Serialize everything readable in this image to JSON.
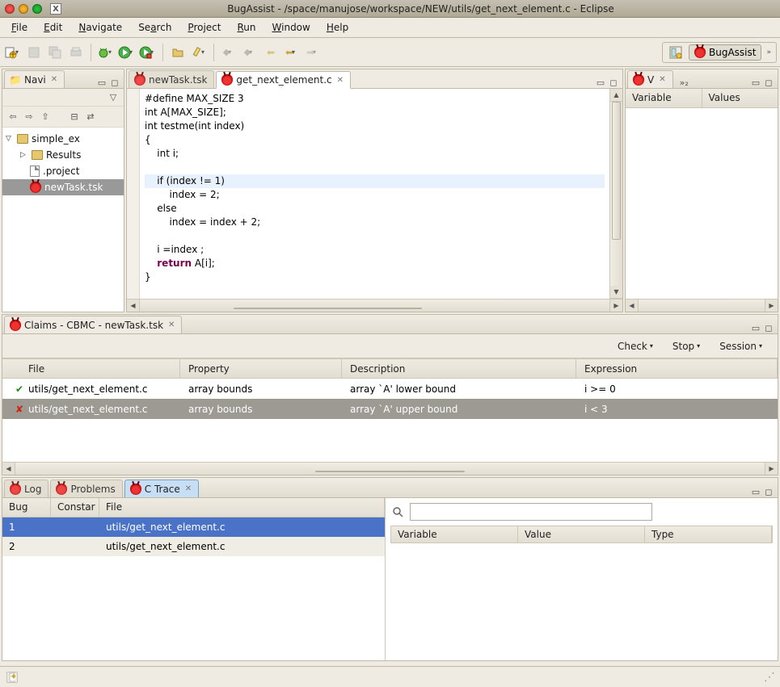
{
  "window": {
    "title": "BugAssist - /space/manujose/workspace/NEW/utils/get_next_element.c - Eclipse"
  },
  "menu": [
    "File",
    "Edit",
    "Navigate",
    "Search",
    "Project",
    "Run",
    "Window",
    "Help"
  ],
  "perspective": {
    "open_label": "",
    "current": "BugAssist"
  },
  "navigator": {
    "title": "Navi",
    "project": "simple_ex",
    "items": [
      {
        "label": "Results",
        "type": "folder"
      },
      {
        "label": ".project",
        "type": "file"
      },
      {
        "label": "newTask.tsk",
        "type": "bug",
        "selected": true
      }
    ]
  },
  "editor": {
    "tabs": [
      {
        "label": "newTask.tsk",
        "active": false,
        "icon": "bug"
      },
      {
        "label": "get_next_element.c",
        "active": true,
        "icon": "bug"
      }
    ],
    "code": {
      "l1": "#define MAX_SIZE 3",
      "l2": "int A[MAX_SIZE];",
      "l3": "int testme(int index)",
      "l4": "{",
      "l5": "    int i;",
      "l6": "",
      "l7": "    if (index != 1)",
      "l8": "        index = 2;",
      "l9": "    else",
      "l10": "        index = index + 2;",
      "l11": "",
      "l12": "    i =index ;",
      "l13a": "    ",
      "l13b": "return",
      "l13c": " A[i];",
      "l14": "}"
    }
  },
  "vars_view": {
    "title": "V",
    "extra_tabs_label": "»₂",
    "cols": [
      "Variable",
      "Values"
    ]
  },
  "claims": {
    "title": "Claims - CBMC - newTask.tsk",
    "actions": [
      "Check",
      "Stop",
      "Session"
    ],
    "headers": [
      "File",
      "Property",
      "Description",
      "Expression"
    ],
    "rows": [
      {
        "status": "ok",
        "file": "utils/get_next_element.c",
        "property": "array bounds",
        "description": "array `A' lower bound",
        "expression": "i >= 0"
      },
      {
        "status": "fail",
        "file": "utils/get_next_element.c",
        "property": "array bounds",
        "description": "array `A' upper bound",
        "expression": "i < 3"
      }
    ]
  },
  "bottom": {
    "tabs": [
      "Log",
      "Problems",
      "C Trace"
    ],
    "active_tab": "C Trace",
    "trace_headers": [
      "Bug",
      "Constar",
      "File"
    ],
    "trace_rows": [
      {
        "bug": "1",
        "constar": "",
        "file": "utils/get_next_element.c",
        "selected": true
      },
      {
        "bug": "2",
        "constar": "",
        "file": "utils/get_next_element.c",
        "selected": false
      }
    ],
    "right_headers": [
      "Variable",
      "Value",
      "Type"
    ],
    "search_placeholder": ""
  }
}
